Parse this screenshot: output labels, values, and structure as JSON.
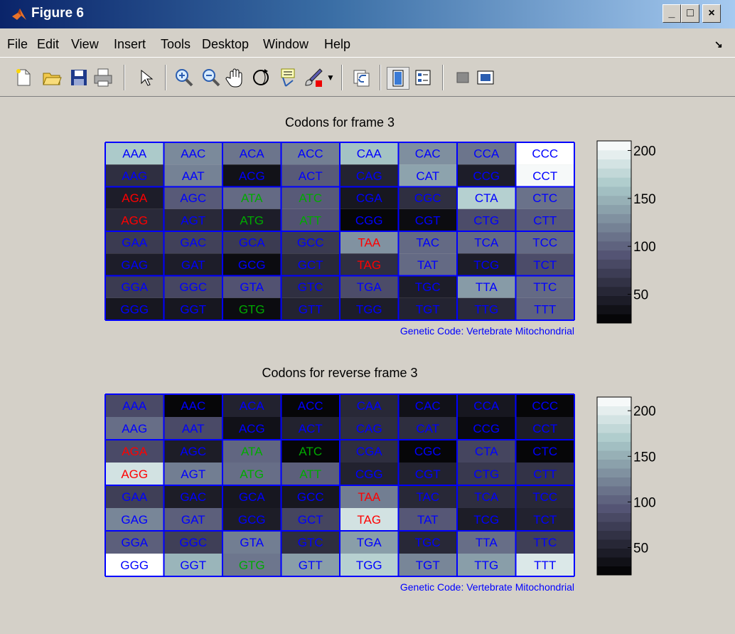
{
  "window": {
    "title": "Figure 6",
    "min": "_",
    "max": "□",
    "close": "×"
  },
  "menu": [
    "File",
    "Edit",
    "View",
    "Insert",
    "Tools",
    "Desktop",
    "Window",
    "Help"
  ],
  "toolbar_icons": [
    "new-file-icon",
    "open-folder-icon",
    "save-icon",
    "print-icon",
    "pointer-icon",
    "zoom-in-icon",
    "zoom-out-icon",
    "pan-hand-icon",
    "rotate-3d-icon",
    "data-cursor-icon",
    "brush-icon",
    "brush-dropdown-icon",
    "link-plot-icon",
    "colorbar-toggle-icon",
    "legend-toggle-icon",
    "hide-plot-tools-icon",
    "show-plot-tools-icon"
  ],
  "chart_data": [
    {
      "type": "heatmap",
      "title": "Codons for frame 3",
      "footer": "Genetic Code: Vertebrate Mitochondrial",
      "colorbar_ticks": [
        "200",
        "150",
        "100",
        "50"
      ],
      "colorbar_range": [
        20,
        210
      ],
      "rows": [
        [
          [
            "AAA",
            165,
            "#0000ff"
          ],
          [
            "AAC",
            125,
            "#0000ff"
          ],
          [
            "ACA",
            112,
            "#0000ff"
          ],
          [
            "ACC",
            118,
            "#0000ff"
          ],
          [
            "CAA",
            160,
            "#0000ff"
          ],
          [
            "CAC",
            128,
            "#0000ff"
          ],
          [
            "CCA",
            112,
            "#0000ff"
          ],
          [
            "CCC",
            210,
            "#0000ff"
          ]
        ],
        [
          [
            "AAG",
            60,
            "#0000ff"
          ],
          [
            "AAT",
            120,
            "#0000ff"
          ],
          [
            "ACG",
            35,
            "#0000ff"
          ],
          [
            "ACT",
            95,
            "#0000ff"
          ],
          [
            "CAG",
            50,
            "#0000ff"
          ],
          [
            "CAT",
            140,
            "#0000ff"
          ],
          [
            "CCG",
            45,
            "#0000ff"
          ],
          [
            "CCT",
            205,
            "#0000ff"
          ]
        ],
        [
          [
            "AGA",
            45,
            "#ff0000"
          ],
          [
            "AGC",
            95,
            "#0000ff"
          ],
          [
            "ATA",
            105,
            "#00aa00"
          ],
          [
            "ATC",
            95,
            "#00aa00"
          ],
          [
            "CGA",
            40,
            "#0000ff"
          ],
          [
            "CGC",
            60,
            "#0000ff"
          ],
          [
            "CTA",
            170,
            "#0000ff"
          ],
          [
            "CTC",
            110,
            "#0000ff"
          ]
        ],
        [
          [
            "AGG",
            55,
            "#ff0000"
          ],
          [
            "AGT",
            55,
            "#0000ff"
          ],
          [
            "ATG",
            45,
            "#00aa00"
          ],
          [
            "ATT",
            90,
            "#00aa00"
          ],
          [
            "CGG",
            25,
            "#0000ff"
          ],
          [
            "CGT",
            30,
            "#0000ff"
          ],
          [
            "CTG",
            85,
            "#0000ff"
          ],
          [
            "CTT",
            95,
            "#0000ff"
          ]
        ],
        [
          [
            "GAA",
            70,
            "#0000ff"
          ],
          [
            "GAC",
            75,
            "#0000ff"
          ],
          [
            "GCA",
            70,
            "#0000ff"
          ],
          [
            "GCC",
            70,
            "#0000ff"
          ],
          [
            "TAA",
            130,
            "#ff0000"
          ],
          [
            "TAC",
            105,
            "#0000ff"
          ],
          [
            "TCA",
            105,
            "#0000ff"
          ],
          [
            "TCC",
            105,
            "#0000ff"
          ]
        ],
        [
          [
            "GAG",
            45,
            "#0000ff"
          ],
          [
            "GAT",
            45,
            "#0000ff"
          ],
          [
            "GCG",
            30,
            "#0000ff"
          ],
          [
            "GCT",
            55,
            "#0000ff"
          ],
          [
            "TAG",
            60,
            "#ff0000"
          ],
          [
            "TAT",
            105,
            "#0000ff"
          ],
          [
            "TCG",
            45,
            "#0000ff"
          ],
          [
            "TCT",
            85,
            "#0000ff"
          ]
        ],
        [
          [
            "GGA",
            70,
            "#0000ff"
          ],
          [
            "GGC",
            80,
            "#0000ff"
          ],
          [
            "GTA",
            90,
            "#0000ff"
          ],
          [
            "GTC",
            60,
            "#0000ff"
          ],
          [
            "TGA",
            85,
            "#0000ff"
          ],
          [
            "TGC",
            45,
            "#0000ff"
          ],
          [
            "TTA",
            135,
            "#0000ff"
          ],
          [
            "TTC",
            105,
            "#0000ff"
          ]
        ],
        [
          [
            "GGG",
            40,
            "#0000ff"
          ],
          [
            "GGT",
            40,
            "#0000ff"
          ],
          [
            "GTG",
            30,
            "#00aa00"
          ],
          [
            "GTT",
            50,
            "#0000ff"
          ],
          [
            "TGG",
            45,
            "#0000ff"
          ],
          [
            "TGT",
            50,
            "#0000ff"
          ],
          [
            "TTG",
            55,
            "#0000ff"
          ],
          [
            "TTT",
            100,
            "#0000ff"
          ]
        ]
      ]
    },
    {
      "type": "heatmap",
      "title": "Codons for reverse frame 3",
      "footer": "Genetic Code: Vertebrate Mitochondrial",
      "colorbar_ticks": [
        "200",
        "150",
        "100",
        "50"
      ],
      "colorbar_range": [
        20,
        215
      ],
      "rows": [
        [
          [
            "AAA",
            85,
            "#0000ff"
          ],
          [
            "AAC",
            25,
            "#0000ff"
          ],
          [
            "ACA",
            50,
            "#0000ff"
          ],
          [
            "ACC",
            25,
            "#0000ff"
          ],
          [
            "CAA",
            55,
            "#0000ff"
          ],
          [
            "CAC",
            35,
            "#0000ff"
          ],
          [
            "CCA",
            40,
            "#0000ff"
          ],
          [
            "CCC",
            25,
            "#0000ff"
          ]
        ],
        [
          [
            "AAG",
            110,
            "#0000ff"
          ],
          [
            "AAT",
            85,
            "#0000ff"
          ],
          [
            "ACG",
            35,
            "#0000ff"
          ],
          [
            "ACT",
            50,
            "#0000ff"
          ],
          [
            "CAG",
            60,
            "#0000ff"
          ],
          [
            "CAT",
            60,
            "#0000ff"
          ],
          [
            "CCG",
            30,
            "#0000ff"
          ],
          [
            "CCT",
            45,
            "#0000ff"
          ]
        ],
        [
          [
            "AGA",
            85,
            "#ff0000"
          ],
          [
            "AGC",
            45,
            "#0000ff"
          ],
          [
            "ATA",
            105,
            "#00aa00"
          ],
          [
            "ATC",
            25,
            "#00aa00"
          ],
          [
            "CGA",
            60,
            "#0000ff"
          ],
          [
            "CGC",
            25,
            "#0000ff"
          ],
          [
            "CTA",
            80,
            "#0000ff"
          ],
          [
            "CTC",
            25,
            "#0000ff"
          ]
        ],
        [
          [
            "AGG",
            190,
            "#ff0000"
          ],
          [
            "AGT",
            120,
            "#0000ff"
          ],
          [
            "ATG",
            110,
            "#00aa00"
          ],
          [
            "ATT",
            100,
            "#00aa00"
          ],
          [
            "CGG",
            50,
            "#0000ff"
          ],
          [
            "CGT",
            50,
            "#0000ff"
          ],
          [
            "CTG",
            70,
            "#0000ff"
          ],
          [
            "CTT",
            65,
            "#0000ff"
          ]
        ],
        [
          [
            "GAA",
            75,
            "#0000ff"
          ],
          [
            "GAC",
            45,
            "#0000ff"
          ],
          [
            "GCA",
            40,
            "#0000ff"
          ],
          [
            "GCC",
            40,
            "#0000ff"
          ],
          [
            "TAA",
            120,
            "#ff0000"
          ],
          [
            "TAC",
            55,
            "#0000ff"
          ],
          [
            "TCA",
            60,
            "#0000ff"
          ],
          [
            "TCC",
            55,
            "#0000ff"
          ]
        ],
        [
          [
            "GAG",
            125,
            "#0000ff"
          ],
          [
            "GAT",
            100,
            "#0000ff"
          ],
          [
            "GCG",
            45,
            "#0000ff"
          ],
          [
            "GCT",
            80,
            "#0000ff"
          ],
          [
            "TAG",
            190,
            "#ff0000"
          ],
          [
            "TAT",
            95,
            "#0000ff"
          ],
          [
            "TCG",
            45,
            "#0000ff"
          ],
          [
            "TCT",
            50,
            "#0000ff"
          ]
        ],
        [
          [
            "GGA",
            100,
            "#0000ff"
          ],
          [
            "GGC",
            75,
            "#0000ff"
          ],
          [
            "GTA",
            120,
            "#0000ff"
          ],
          [
            "GTC",
            60,
            "#0000ff"
          ],
          [
            "TGA",
            140,
            "#0000ff"
          ],
          [
            "TGC",
            55,
            "#0000ff"
          ],
          [
            "TTA",
            110,
            "#0000ff"
          ],
          [
            "TTC",
            75,
            "#0000ff"
          ]
        ],
        [
          [
            "GGG",
            215,
            "#0000ff"
          ],
          [
            "GGT",
            155,
            "#0000ff"
          ],
          [
            "GTG",
            115,
            "#00aa00"
          ],
          [
            "GTT",
            140,
            "#0000ff"
          ],
          [
            "TGG",
            175,
            "#0000ff"
          ],
          [
            "TGT",
            125,
            "#0000ff"
          ],
          [
            "TTG",
            140,
            "#0000ff"
          ],
          [
            "TTT",
            195,
            "#0000ff"
          ]
        ]
      ]
    }
  ]
}
